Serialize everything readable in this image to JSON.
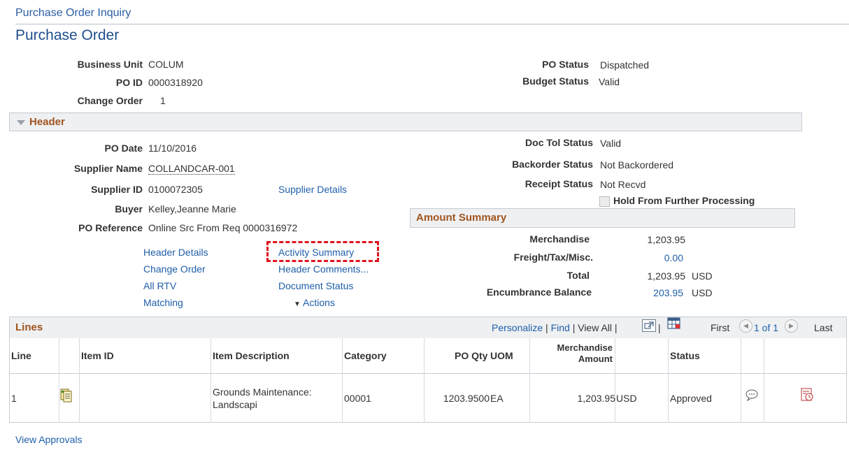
{
  "breadcrumb": "Purchase Order Inquiry",
  "page_title": "Purchase Order",
  "top": {
    "business_unit_label": "Business Unit",
    "business_unit": "COLUM",
    "po_id_label": "PO ID",
    "po_id": "0000318920",
    "change_order_label": "Change Order",
    "change_order": "1",
    "po_status_label": "PO Status",
    "po_status": "Dispatched",
    "budget_status_label": "Budget Status",
    "budget_status": "Valid"
  },
  "header": {
    "title": "Header",
    "po_date_label": "PO Date",
    "po_date": "11/10/2016",
    "supplier_name_label": "Supplier Name",
    "supplier_name": "COLLANDCAR-001",
    "supplier_id_label": "Supplier ID",
    "supplier_id": "0100072305",
    "supplier_details": "Supplier Details",
    "buyer_label": "Buyer",
    "buyer": "Kelley,Jeanne Marie",
    "po_reference_label": "PO Reference",
    "po_reference": "Online Src From Req 0000316972",
    "doc_tol_label": "Doc Tol Status",
    "doc_tol": "Valid",
    "backorder_label": "Backorder Status",
    "backorder": "Not Backordered",
    "receipt_label": "Receipt Status",
    "receipt": "Not Recvd",
    "hold_label": "Hold From Further Processing",
    "links": {
      "header_details": "Header Details",
      "change_order": "Change Order",
      "all_rtv": "All RTV",
      "matching": "Matching",
      "activity_summary": "Activity Summary",
      "header_comments": "Header Comments...",
      "document_status": "Document Status",
      "actions": "Actions"
    }
  },
  "amount_summary": {
    "title": "Amount Summary",
    "merchandise_label": "Merchandise",
    "merchandise": "1,203.95",
    "freight_label": "Freight/Tax/Misc.",
    "freight": "0.00",
    "total_label": "Total",
    "total": "1,203.95",
    "total_currency": "USD",
    "encumbrance_label": "Encumbrance Balance",
    "encumbrance": "203.95",
    "encumbrance_currency": "USD"
  },
  "lines": {
    "title": "Lines",
    "personalize": "Personalize",
    "find": "Find",
    "view_all": "View All",
    "first": "First",
    "page_info": "1 of 1",
    "last": "Last",
    "columns": {
      "line": "Line",
      "item_id": "Item ID",
      "item_description": "Item Description",
      "category": "Category",
      "po_qty": "PO Qty",
      "uom": "UOM",
      "merch_amount_1": "Merchandise",
      "merch_amount_2": "Amount",
      "status": "Status"
    },
    "rows": [
      {
        "line": "1",
        "item_id": "",
        "desc_1": "Grounds Maintenance:",
        "desc_2": "Landscapi",
        "category": "00001",
        "po_qty": "1203.9500",
        "uom": "EA",
        "amount": "1,203.95",
        "currency": "USD",
        "status": "Approved"
      }
    ]
  },
  "view_approvals": "View Approvals",
  "colors": {
    "link": "#1f5fa8",
    "section_title": "#a0541f",
    "highlight": "#e0141e"
  }
}
